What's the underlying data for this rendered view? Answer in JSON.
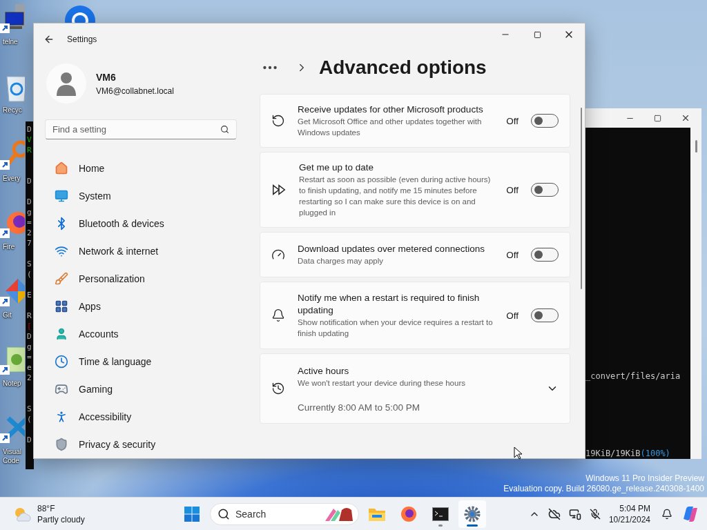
{
  "desktop_icons": [
    {
      "label": "telne"
    },
    {
      "label": "Recyc"
    },
    {
      "label": "Every"
    },
    {
      "label": "Fire"
    },
    {
      "label": "Git"
    },
    {
      "label": "Notep"
    },
    {
      "label": "Visual Code"
    }
  ],
  "background_console": {
    "lines": [
      {
        "kind": "plain",
        "text": "D"
      },
      {
        "kind": "success",
        "text": "V"
      },
      {
        "kind": "success",
        "text": "R"
      },
      {
        "kind": "blank"
      },
      {
        "kind": "blank"
      },
      {
        "kind": "plain",
        "text": "D"
      },
      {
        "kind": "blank"
      },
      {
        "kind": "plain",
        "text": "D"
      },
      {
        "kind": "plain",
        "text": "g"
      },
      {
        "kind": "plain",
        "text": "="
      },
      {
        "kind": "plain",
        "text": "2"
      },
      {
        "kind": "plain",
        "text": "7"
      },
      {
        "kind": "blank"
      },
      {
        "kind": "plain",
        "text": "S"
      },
      {
        "kind": "plain",
        "text": "("
      },
      {
        "kind": "blank"
      },
      {
        "kind": "plain",
        "text": "E"
      },
      {
        "kind": "blank"
      },
      {
        "kind": "plain",
        "text": "R"
      },
      {
        "kind": "error",
        "text": "["
      },
      {
        "kind": "plain",
        "text": "D"
      },
      {
        "kind": "plain",
        "text": "g"
      },
      {
        "kind": "plain",
        "text": "="
      },
      {
        "kind": "plain",
        "text": "e"
      },
      {
        "kind": "plain",
        "text": "2"
      },
      {
        "kind": "blank"
      },
      {
        "kind": "blank"
      },
      {
        "kind": "plain",
        "text": "S"
      },
      {
        "kind": "plain",
        "text": "("
      },
      {
        "kind": "blank"
      },
      {
        "kind": "plain",
        "text": "D"
      }
    ]
  },
  "console_window": {
    "lines": [
      {
        "parts": [
          {
            "text": "_convert/files/aria",
            "kind": "plain"
          }
        ]
      },
      {
        "parts": [
          {
            "text": "19KiB/19KiB",
            "kind": "plain"
          },
          {
            "text": "(100%)",
            "kind": "accent"
          }
        ]
      }
    ]
  },
  "watermark": {
    "edition": "Windows 11 Pro Insider Preview",
    "build": "Evaluation copy. Build 26080.ge_release.240308-1400"
  },
  "settings": {
    "title": "Settings",
    "profile": {
      "name": "VM6",
      "email": "VM6@collabnet.local"
    },
    "search": {
      "placeholder": "Find a setting"
    },
    "nav": [
      {
        "label": "Home",
        "selected": false
      },
      {
        "label": "System",
        "selected": false
      },
      {
        "label": "Bluetooth & devices",
        "selected": false
      },
      {
        "label": "Network & internet",
        "selected": false
      },
      {
        "label": "Personalization",
        "selected": false
      },
      {
        "label": "Apps",
        "selected": false
      },
      {
        "label": "Accounts",
        "selected": false
      },
      {
        "label": "Time & language",
        "selected": false
      },
      {
        "label": "Gaming",
        "selected": false
      },
      {
        "label": "Accessibility",
        "selected": false
      },
      {
        "label": "Privacy & security",
        "selected": false
      }
    ],
    "page_title": "Advanced options",
    "options": [
      {
        "kind": "toggle",
        "title": "Receive updates for other Microsoft products",
        "description": "Get Microsoft Office and other updates together with Windows updates",
        "state_label": "Off",
        "on": false
      },
      {
        "kind": "toggle",
        "title": "Get me up to date",
        "description": "Restart as soon as possible (even during active hours) to finish updating, and notify me 15 minutes before restarting so I can make sure this device is on and plugged in",
        "state_label": "Off",
        "on": false
      },
      {
        "kind": "toggle",
        "title": "Download updates over metered connections",
        "description": "Data charges may apply",
        "state_label": "Off",
        "on": false
      },
      {
        "kind": "toggle",
        "title": "Notify me when a restart is required to finish updating",
        "description": "Show notification when your device requires a restart to finish updating",
        "state_label": "Off",
        "on": false
      },
      {
        "kind": "expander",
        "title": "Active hours",
        "description": "We won't restart your device during these hours",
        "value": "Currently 8:00 AM to 5:00 PM",
        "expanded": false
      }
    ]
  },
  "taskbar": {
    "weather": {
      "temperature": "88°F",
      "condition": "Partly cloudy"
    },
    "search": {
      "placeholder": "Search"
    },
    "apps": [
      {
        "running": false,
        "active": false
      },
      {
        "running": false,
        "active": false
      },
      {
        "running": true,
        "active": false
      },
      {
        "running": true,
        "active": true
      }
    ],
    "clock": {
      "time": "5:04 PM",
      "date": "10/21/2024"
    }
  }
}
